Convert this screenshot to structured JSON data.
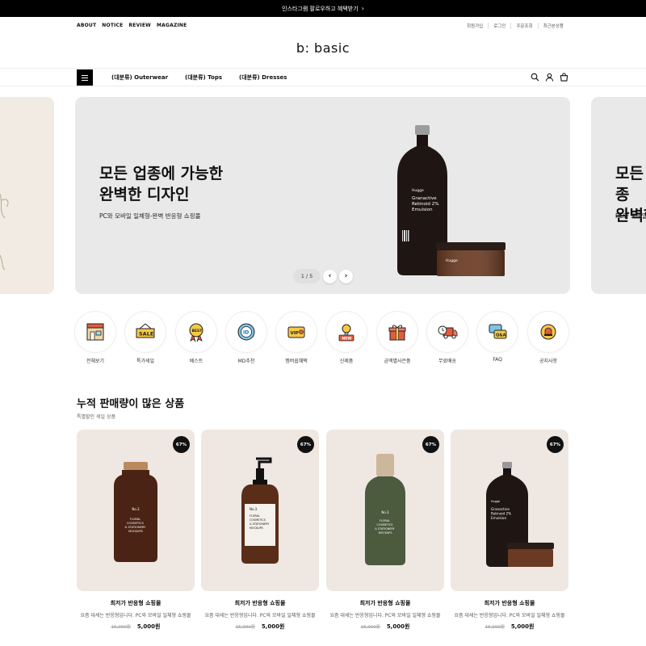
{
  "announcement": {
    "text": "인스타그램 팔로우하고 혜택받기",
    "arrow": "›"
  },
  "util": {
    "left_links": [
      "ABOUT",
      "NOTICE",
      "REVIEW",
      "MAGAZINE"
    ],
    "right_links": [
      "회원가입",
      "로그인",
      "주문조회",
      "최근본상품"
    ]
  },
  "brand": {
    "logo": "b: basic"
  },
  "nav": {
    "items": [
      "(대분류) Outerwear",
      "(대분류) Tops",
      "(대분류) Dresses"
    ],
    "icons": [
      "search-icon",
      "user-icon",
      "cart-icon"
    ]
  },
  "hero": {
    "title": "모든 업종에 가능한\n완벽한 디자인",
    "subtitle": "PC와 모바일 일체형-완벽 반응형 쇼핑몰",
    "pager": "1 / 5",
    "prev": "‹",
    "next": "›",
    "bottle_label": "Granactive\nRetinoid 2%\nEmulsion",
    "bottle_brand": "Hugge",
    "jar_brand": "Hugge",
    "peek_title": "모든 업종\n완벽한",
    "peek_subtitle": "PC와 모바일 일체형"
  },
  "categories": [
    {
      "label": "전체보기",
      "icon": "store-icon"
    },
    {
      "label": "특가세일",
      "icon": "sale-sign-icon"
    },
    {
      "label": "베스트",
      "icon": "best-medal-icon"
    },
    {
      "label": "MD추천",
      "icon": "md-badge-icon"
    },
    {
      "label": "멤버쉽혜택",
      "icon": "vip-card-icon"
    },
    {
      "label": "신제품",
      "icon": "new-bulb-icon"
    },
    {
      "label": "금액별사은품",
      "icon": "gift-icon"
    },
    {
      "label": "무료배송",
      "icon": "delivery-truck-icon"
    },
    {
      "label": "FAQ",
      "icon": "faq-chat-icon"
    },
    {
      "label": "공지사항",
      "icon": "notice-bell-icon"
    }
  ],
  "section": {
    "title": "누적 판매량이 많은 상품",
    "subtitle": "특별할인 세일 상품"
  },
  "products": [
    {
      "badge": "67%",
      "name": "최저가 반응형 쇼핑몰",
      "desc": "요즘 대세는 반응형입니다. PC와 모바일 일체형 쇼핑몰",
      "old_price": "15,000원",
      "price": "5,000원",
      "art": "amber-bottle"
    },
    {
      "badge": "67%",
      "name": "최저가 반응형 쇼핑몰",
      "desc": "요즘 대세는 반응형입니다. PC와 모바일 일체형 쇼핑몰",
      "old_price": "15,000원",
      "price": "5,000원",
      "art": "pump-bottle"
    },
    {
      "badge": "67%",
      "name": "최저가 반응형 쇼핑몰",
      "desc": "요즘 대세는 반응형입니다. PC와 모바일 일체형 쇼핑몰",
      "old_price": "15,000원",
      "price": "5,000원",
      "art": "green-bottle"
    },
    {
      "badge": "67%",
      "name": "최저가 반응형 쇼핑몰",
      "desc": "요즘 대세는 반응형입니다. PC와 모바일 일체형 쇼핑몰",
      "old_price": "15,000원",
      "price": "5,000원",
      "art": "black-bottle-jar"
    }
  ],
  "product_label": {
    "no": "No.3",
    "text": "FLORAL\nCOSMETICS\n& STATIONERY\nMOCKUPS",
    "bottle_label": "Granactive\nRetinoid 2%\nEmulsion",
    "bottle_brand": "Hugge"
  },
  "colors": {
    "topbar": "#000000",
    "hero_bg": "#e9e9e9",
    "card_bg": "#efe7e2",
    "badge": "#111111"
  }
}
